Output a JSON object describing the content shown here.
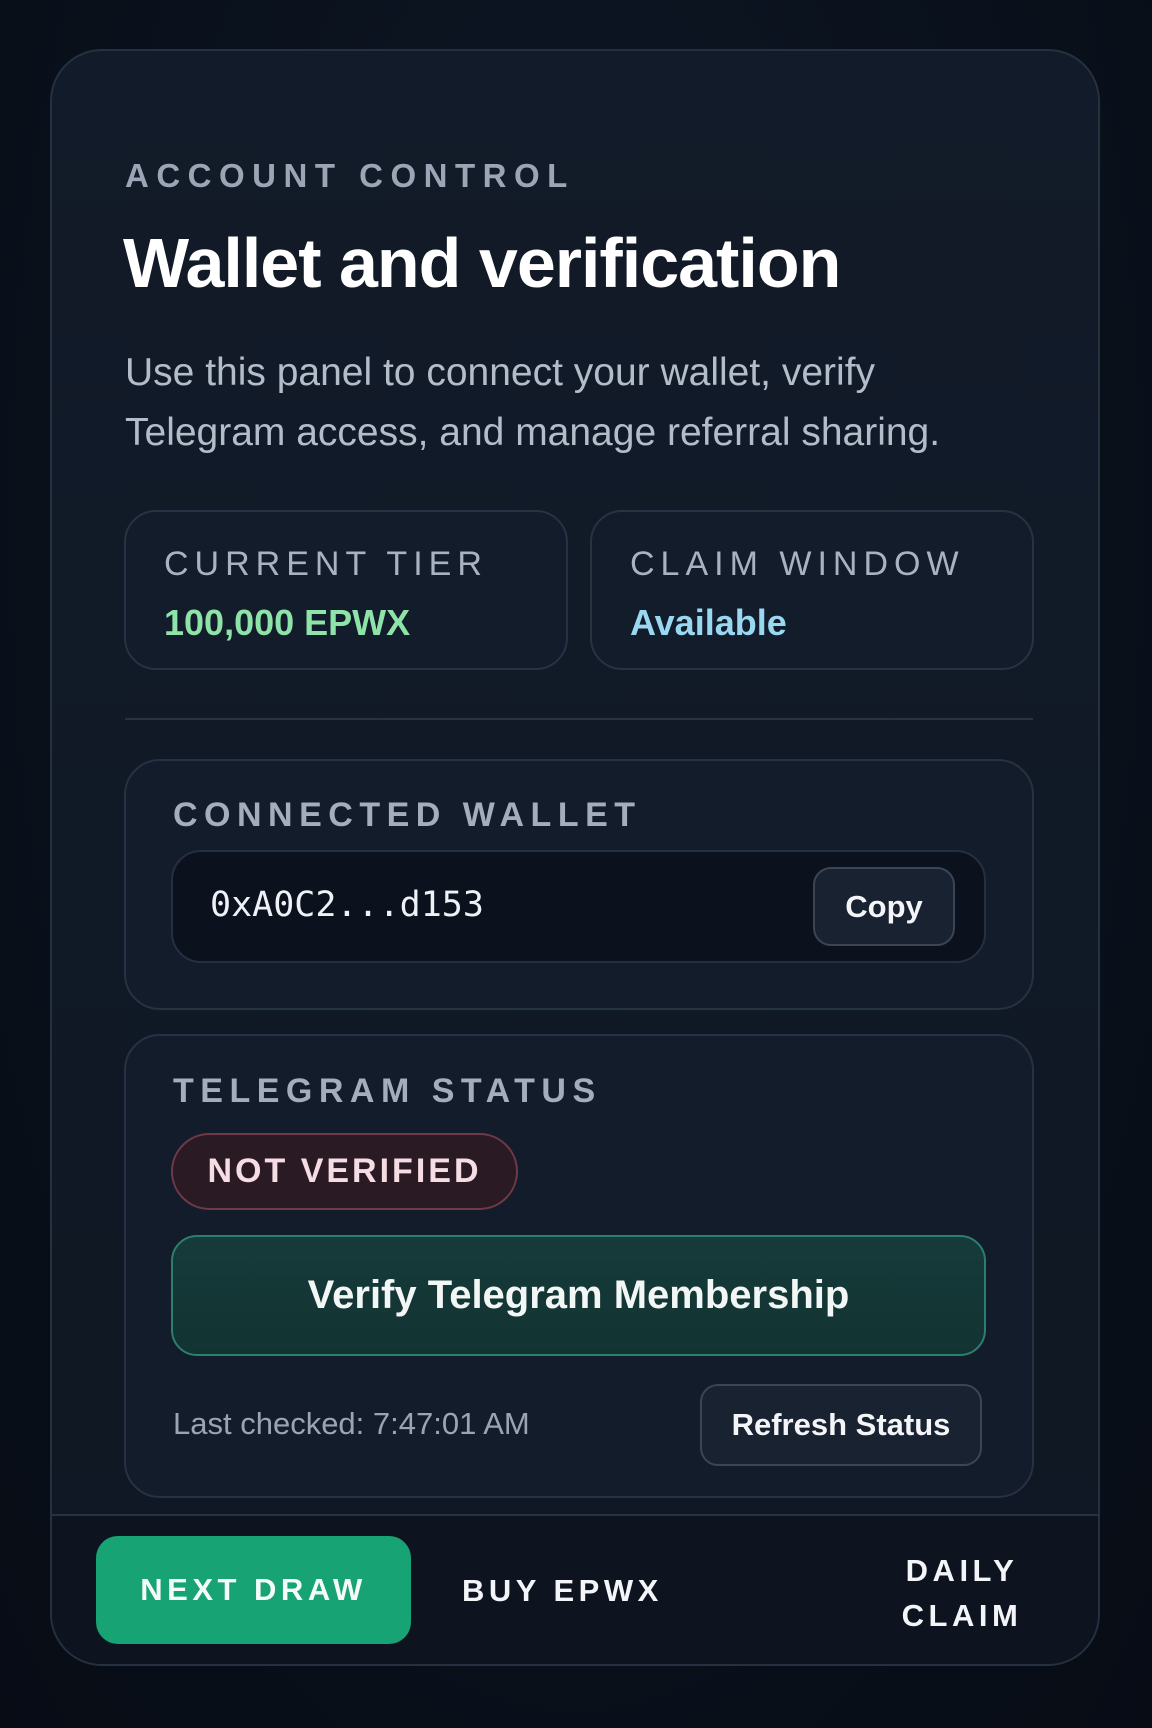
{
  "header": {
    "eyebrow": "ACCOUNT CONTROL",
    "title": "Wallet and verification",
    "description": "Use this panel to connect your wallet, verify Telegram access, and manage referral sharing."
  },
  "stats": {
    "current_tier": {
      "label": "CURRENT TIER",
      "value": "100,000 EPWX",
      "color": "#8ee3a8"
    },
    "claim_window": {
      "label": "CLAIM WINDOW",
      "value": "Available",
      "color": "#9ad8f2"
    }
  },
  "wallet": {
    "label": "CONNECTED WALLET",
    "address": "0xA0C2...d153",
    "copy_label": "Copy"
  },
  "telegram": {
    "label": "TELEGRAM STATUS",
    "status_badge": "NOT VERIFIED",
    "verify_label": "Verify Telegram Membership",
    "last_checked": "Last checked: 7:47:01 AM",
    "refresh_label": "Refresh Status"
  },
  "bottom_nav": {
    "next_draw": "NEXT DRAW",
    "buy": "BUY EPWX",
    "daily_line1": "DAILY",
    "daily_line2": "CLAIM",
    "active_color": "#17a374"
  }
}
